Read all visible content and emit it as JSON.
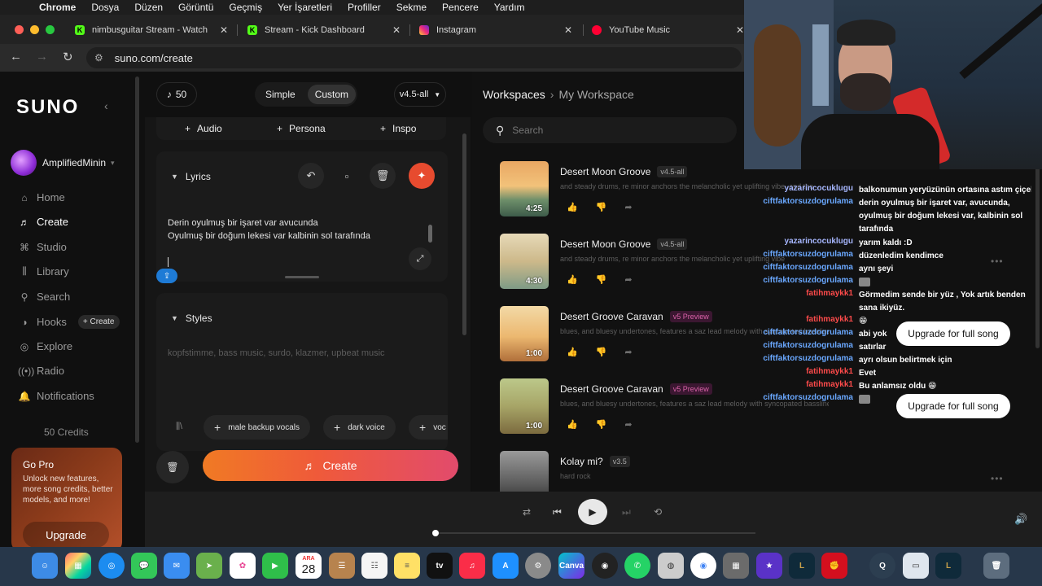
{
  "menubar": {
    "app": "Chrome",
    "items": [
      "Dosya",
      "Düzen",
      "Görüntü",
      "Geçmiş",
      "Yer İşaretleri",
      "Profiller",
      "Sekme",
      "Pencere",
      "Yardım"
    ]
  },
  "tabs": [
    {
      "label": "nimbusguitar Stream - Watch",
      "icon": "kick-icon"
    },
    {
      "label": "Stream - Kick Dashboard",
      "icon": "kick-icon"
    },
    {
      "label": "Instagram",
      "icon": "instagram-icon"
    },
    {
      "label": "YouTube Music",
      "icon": "youtube-music-icon"
    }
  ],
  "url": "suno.com/create",
  "sidebar": {
    "logo": "SUNO",
    "user": "AmplifiedMinin",
    "nav": [
      {
        "label": "Home",
        "icon": "home-icon"
      },
      {
        "label": "Create",
        "icon": "create-icon"
      },
      {
        "label": "Studio",
        "icon": "studio-icon"
      },
      {
        "label": "Library",
        "icon": "library-icon"
      },
      {
        "label": "Search",
        "icon": "search-icon"
      },
      {
        "label": "Hooks",
        "icon": "hooks-icon"
      },
      {
        "label": "Explore",
        "icon": "explore-icon"
      },
      {
        "label": "Radio",
        "icon": "radio-icon"
      },
      {
        "label": "Notifications",
        "icon": "bell-icon"
      }
    ],
    "hooks_create": "+ Create",
    "credits": "50 Credits",
    "gopro": {
      "title": "Go Pro",
      "desc": "Unlock new features, more song credits, better models, and more!",
      "button": "Upgrade"
    }
  },
  "create": {
    "notes_count": "50",
    "mode_simple": "Simple",
    "mode_custom": "Custom",
    "model": "v4.5-all",
    "add": {
      "audio": "Audio",
      "persona": "Persona",
      "inspo": "Inspo"
    },
    "lyrics_title": "Lyrics",
    "lyrics": [
      "Derin oyulmuş bir işaret var avucunda",
      "Oyulmuş bir doğum lekesi var  kalbinin sol tarafında"
    ],
    "styles_title": "Styles",
    "styles_placeholder": "kopfstimme, bass music, surdo, klazmer, upbeat music",
    "chips": [
      "male backup vocals",
      "dark voice",
      "voc"
    ],
    "create_button": "Create"
  },
  "library": {
    "breadcrumb_root": "Workspaces",
    "breadcrumb_current": "My Workspace",
    "search_placeholder": "Search",
    "songs": [
      {
        "title": "Desert Moon Groove",
        "badge": "v4.5-all",
        "desc": "and steady drums, re minor anchors the melancholic yet uplifting vibe, and the",
        "duration": "4:25"
      },
      {
        "title": "Desert Moon Groove",
        "badge": "v4.5-all",
        "desc": "and steady drums, re minor anchors the melancholic yet uplifting vibe",
        "duration": "4:30"
      },
      {
        "title": "Desert Groove Caravan",
        "badge": "v5 Preview",
        "desc": "blues, and bluesy undertones, features a saz lead melody with syncopated basslines, a",
        "duration": "1:00"
      },
      {
        "title": "Desert Groove Caravan",
        "badge": "v5 Preview",
        "desc": "blues, and bluesy undertones, features a saz lead melody with syncopated basslines, a",
        "duration": "1:00"
      },
      {
        "title": "Kolay mi?",
        "badge": "v3.5",
        "desc": "hard rock",
        "duration": ""
      }
    ],
    "upgrade_label": "Upgrade for full song"
  },
  "chat": [
    {
      "user": "yazarincocuklugu",
      "msg": "balkonumun yeryüzünün ortasına astım çiçek"
    },
    {
      "user": "ciftfaktorsuzdogrulama",
      "msg": "derin oyulmuş bir işaret var, avucunda, oyulmuş bir doğum lekesi var, kalbinin sol tarafında"
    },
    {
      "user": "yazarincocuklugu",
      "msg": "yarım kaldı :D"
    },
    {
      "user": "ciftfaktorsuzdogrulama",
      "msg": "düzenledim kendimce"
    },
    {
      "user": "ciftfaktorsuzdogrulama",
      "msg": "aynı şeyi"
    },
    {
      "user": "ciftfaktorsuzdogrulama",
      "msg": ""
    },
    {
      "user": "fatihmaykk1",
      "msg": "Görmedim sende bir yüz , Yok artık benden sana ikiyüz."
    },
    {
      "user": "fatihmaykk1",
      "msg": "😁"
    },
    {
      "user": "ciftfaktorsuzdogrulama",
      "msg": "abi yok"
    },
    {
      "user": "ciftfaktorsuzdogrulama",
      "msg": "satırlar"
    },
    {
      "user": "ciftfaktorsuzdogrulama",
      "msg": "ayrı olsun belirtmek için"
    },
    {
      "user": "fatihmaykk1",
      "msg": "Evet"
    },
    {
      "user": "fatihmaykk1",
      "msg": "Bu anlamsız oldu 😁"
    },
    {
      "user": "ciftfaktorsuzdogrulama",
      "msg": ""
    }
  ],
  "dock": {
    "calendar_month": "ARA",
    "calendar_day": "28"
  },
  "colors": {
    "accent_orange": "#f07a24",
    "accent_pink": "#e24b6c",
    "chat_user_a": "#a7b7ff",
    "chat_user_b": "#6aa8ff",
    "chat_user_c": "#ff4b4b"
  }
}
